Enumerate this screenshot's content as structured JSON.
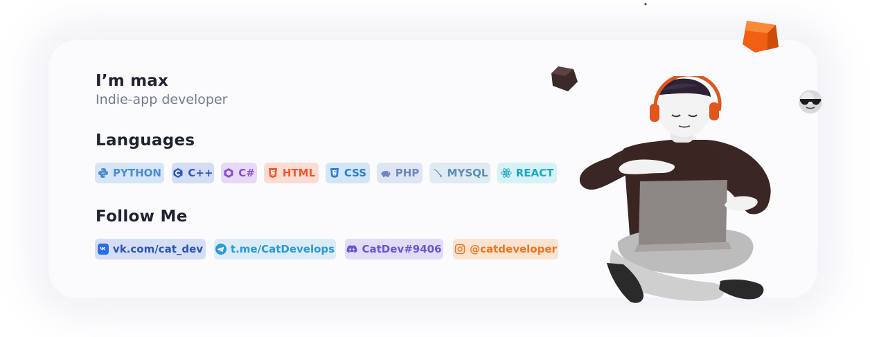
{
  "profile": {
    "name": "I’m max",
    "role": "Indie-app developer"
  },
  "languages": {
    "title": "Languages",
    "items": [
      {
        "label": "PYTHON",
        "icon": "python-icon",
        "fg": "#4b8bd6",
        "bg": "#d6e6f7"
      },
      {
        "label": "C++",
        "icon": "cplusplus-icon",
        "fg": "#2f58b8",
        "bg": "#d3ddf3"
      },
      {
        "label": "C#",
        "icon": "csharp-icon",
        "fg": "#8a4bd6",
        "bg": "#e6daf6"
      },
      {
        "label": "HTML",
        "icon": "html5-icon",
        "fg": "#ee5a2f",
        "bg": "#fbdcd2"
      },
      {
        "label": "CSS",
        "icon": "css3-icon",
        "fg": "#2c7fd3",
        "bg": "#d3e5f7"
      },
      {
        "label": "PHP",
        "icon": "php-icon",
        "fg": "#6f86c4",
        "bg": "#dde6f3"
      },
      {
        "label": "MYSQL",
        "icon": "mysql-icon",
        "fg": "#5d8fb6",
        "bg": "#dfeaf3"
      },
      {
        "label": "REACT",
        "icon": "react-icon",
        "fg": "#17a9c4",
        "bg": "#d6f2f7"
      }
    ]
  },
  "follow": {
    "title": "Follow Me",
    "items": [
      {
        "label": "vk.com/cat_dev",
        "icon": "vk-icon",
        "fg": "#2a56b5",
        "bg": "#d6def6"
      },
      {
        "label": "t.me/CatDevelops",
        "icon": "telegram-icon",
        "fg": "#2c99d6",
        "bg": "#dcecf7"
      },
      {
        "label": "CatDev#9406",
        "icon": "discord-icon",
        "fg": "#6a55d6",
        "bg": "#e3dcf7"
      },
      {
        "label": "@catdeveloper",
        "icon": "instagram-icon",
        "fg": "#ee7620",
        "bg": "#fbe3d2"
      }
    ]
  }
}
